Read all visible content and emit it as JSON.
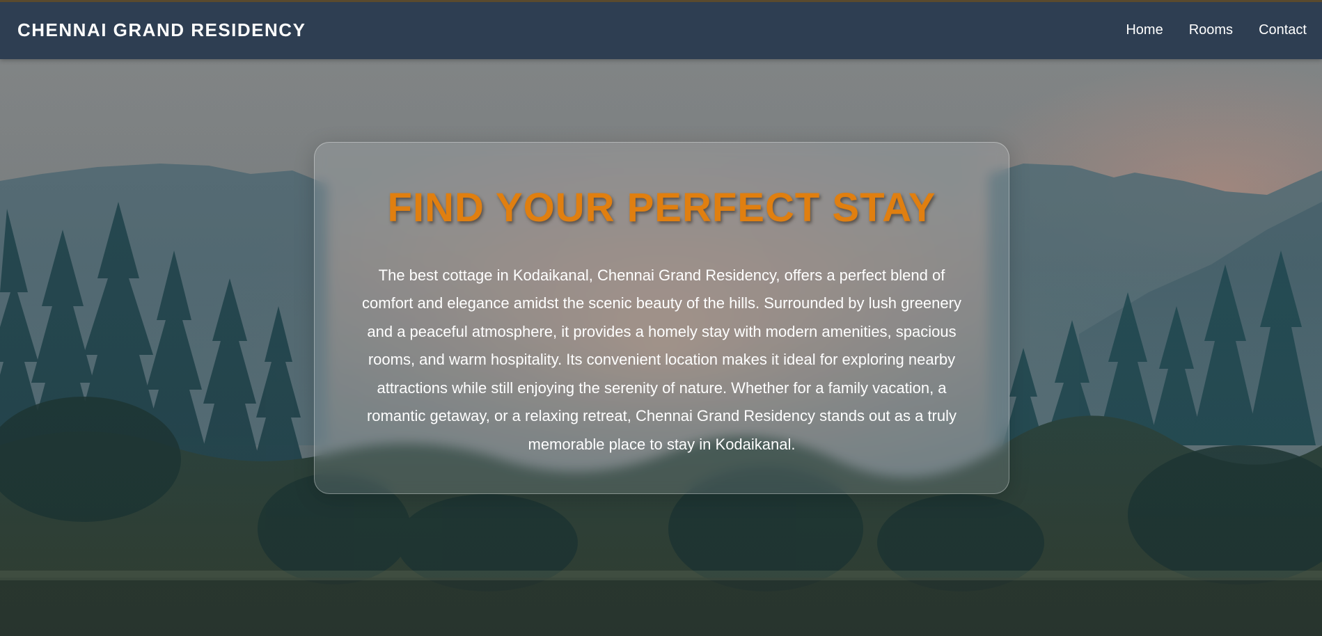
{
  "nav": {
    "brand": "CHENNAI GRAND RESIDENCY",
    "links": [
      {
        "label": "Home"
      },
      {
        "label": "Rooms"
      },
      {
        "label": "Contact"
      }
    ]
  },
  "hero": {
    "title": "FIND YOUR PERFECT STAY",
    "description": "The best cottage in Kodaikanal, Chennai Grand Residency, offers a perfect blend of comfort and elegance amidst the scenic beauty of the hills. Surrounded by lush greenery and a peaceful atmosphere, it provides a homely stay with modern amenities, spacious rooms, and warm hospitality. Its convenient location makes it ideal for exploring nearby attractions while still enjoying the serenity of nature. Whether for a family vacation, a romantic getaway, or a relaxing retreat, Chennai Grand Residency stands out as a truly memorable place to stay in Kodaikanal."
  },
  "colors": {
    "navbar": "#2e3e52",
    "title_accent": "#e07f10",
    "text": "#ffffff"
  },
  "background": {
    "description_icon": "mountain-forest-landscape"
  }
}
